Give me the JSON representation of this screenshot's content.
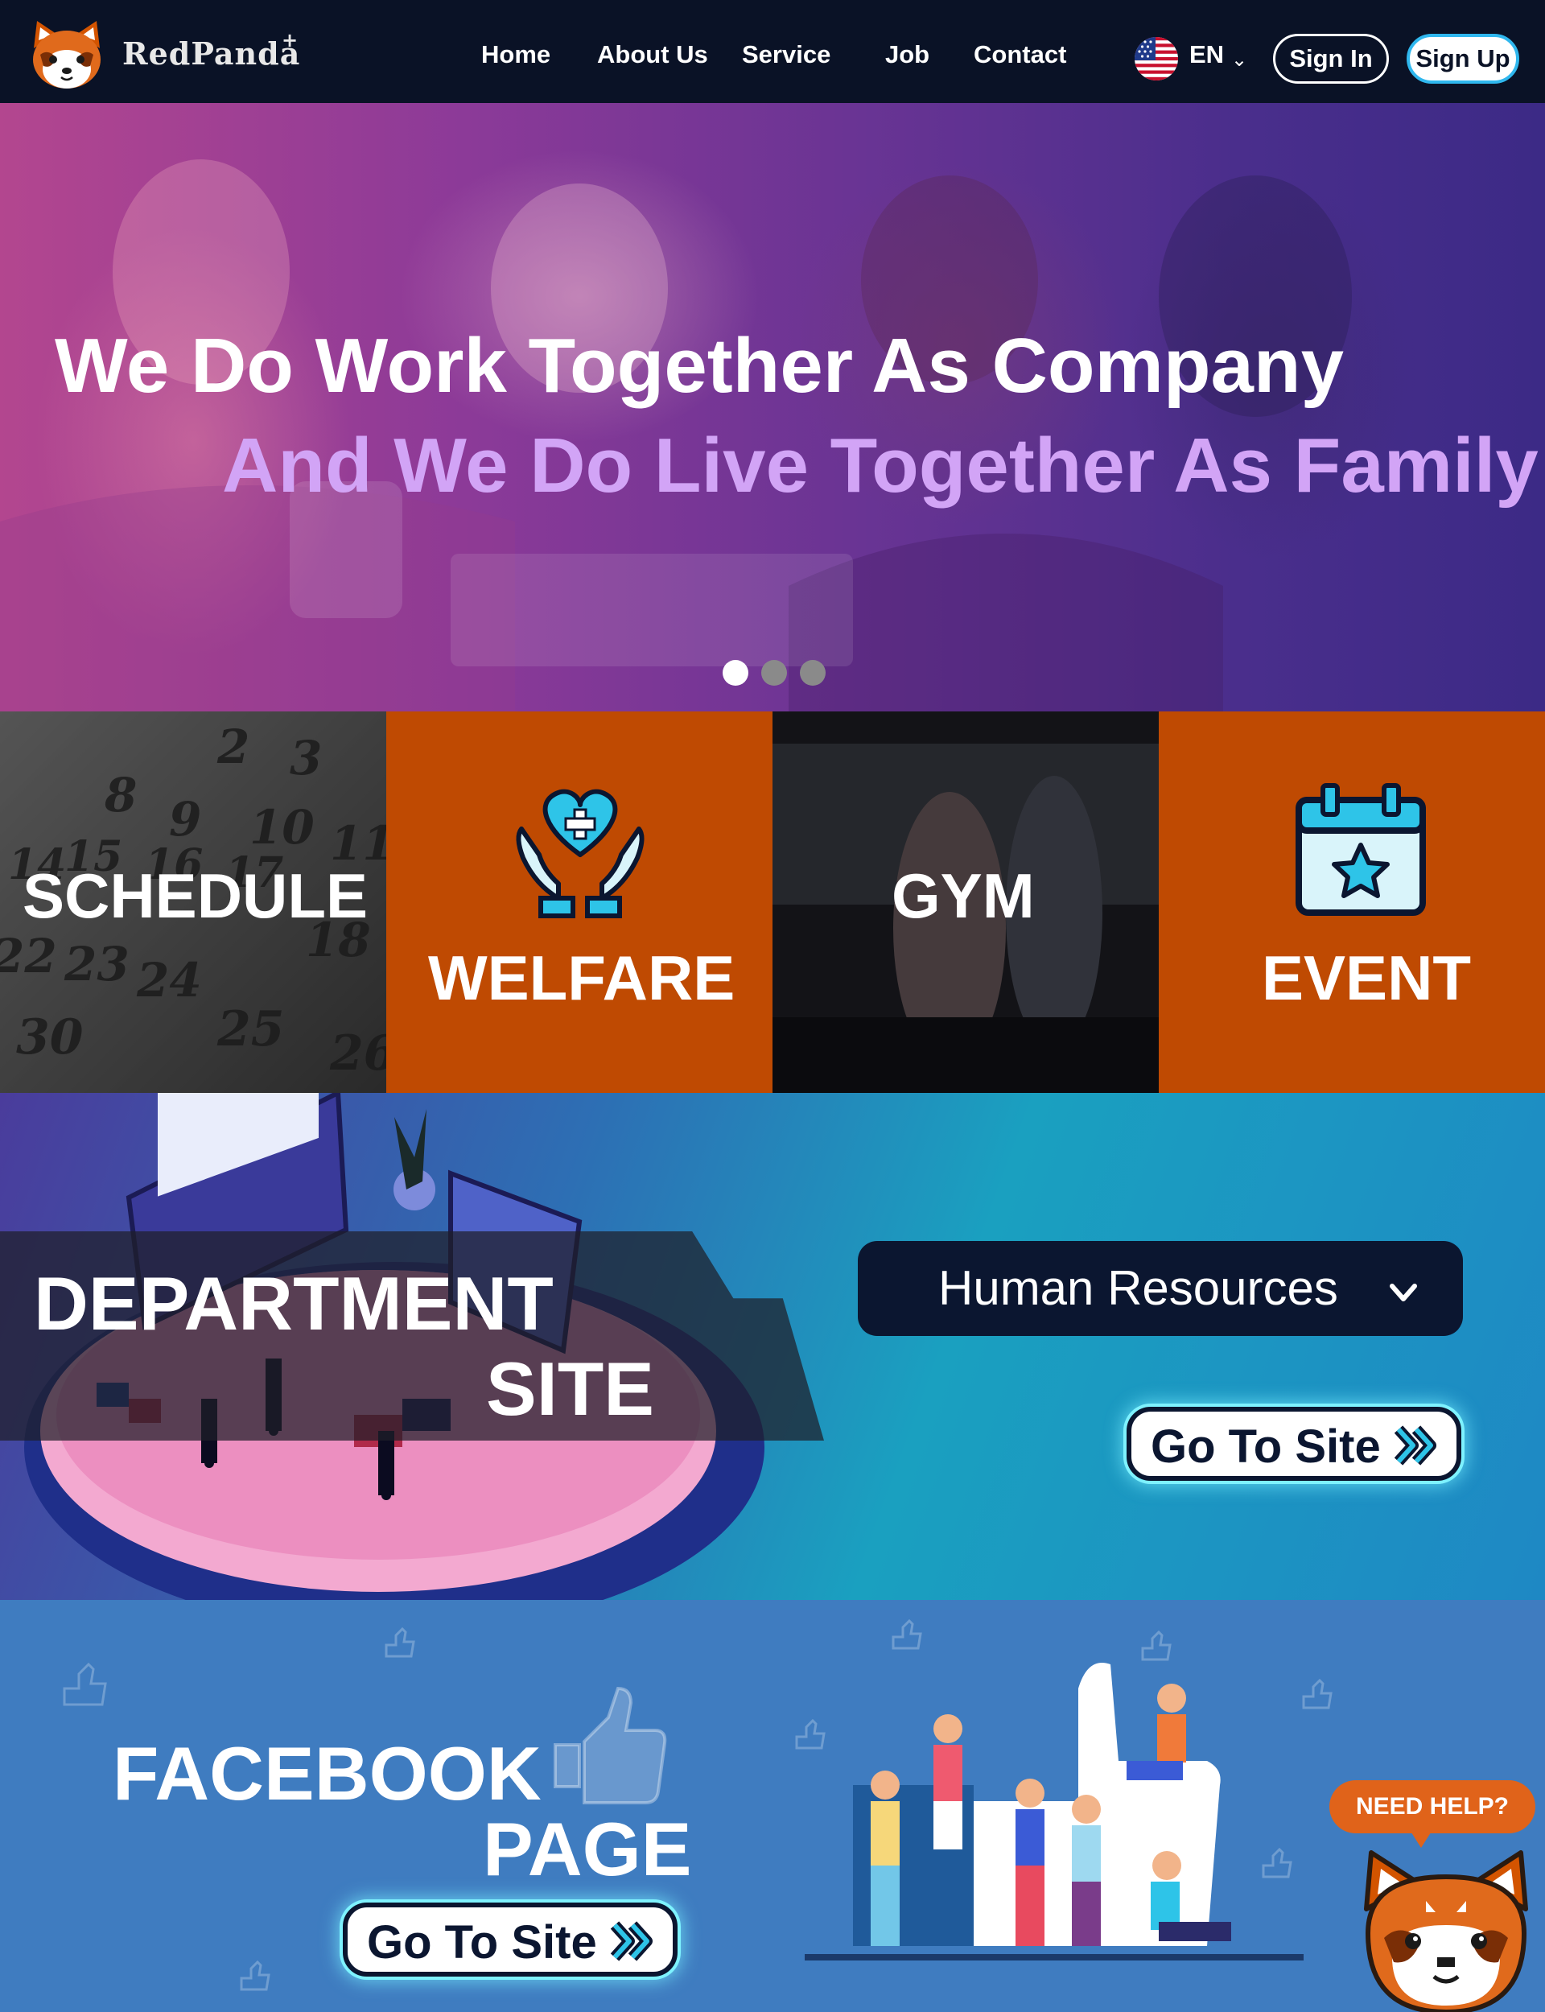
{
  "header": {
    "brand": "RedPanda",
    "brand_sup": "+",
    "nav": [
      "Home",
      "About Us",
      "Service",
      "Job",
      "Contact"
    ],
    "language": "EN",
    "sign_in": "Sign In",
    "sign_up": "Sign Up"
  },
  "hero": {
    "line1": "We Do Work Together As Company",
    "line2": "And We Do Live Together As Family",
    "slides": 3,
    "active_slide": 1
  },
  "tiles": [
    "SCHEDULE",
    "WELFARE",
    "GYM",
    "EVENT"
  ],
  "calendar_numbers": [
    "2",
    "3",
    "8",
    "9",
    "10",
    "11",
    "14",
    "15",
    "16",
    "17",
    "22",
    "23",
    "24",
    "18",
    "30",
    "25",
    "26"
  ],
  "department": {
    "title_line1": "DEPARTMENT",
    "title_line2": "SITE",
    "selected": "Human Resources",
    "go_to_site": "Go To Site"
  },
  "facebook": {
    "title_line1": "FACEBOOK",
    "title_line2": "PAGE",
    "go_to_site": "Go To Site"
  },
  "help": {
    "label": "NEED HELP?"
  },
  "icons": {
    "logo": "red-panda-logo",
    "flag": "us-flag-icon",
    "welfare": "heart-hands-icon",
    "event": "calendar-star-icon",
    "go": "double-chevron-right-icon",
    "dropdown": "chevron-down-icon"
  },
  "colors": {
    "nav_bg": "#0a1226",
    "tile_orange": "#bf4a02",
    "accent_cyan": "#2fb7ee",
    "help_orange": "#e0631a",
    "hero_line2": "#d2a4f6"
  }
}
